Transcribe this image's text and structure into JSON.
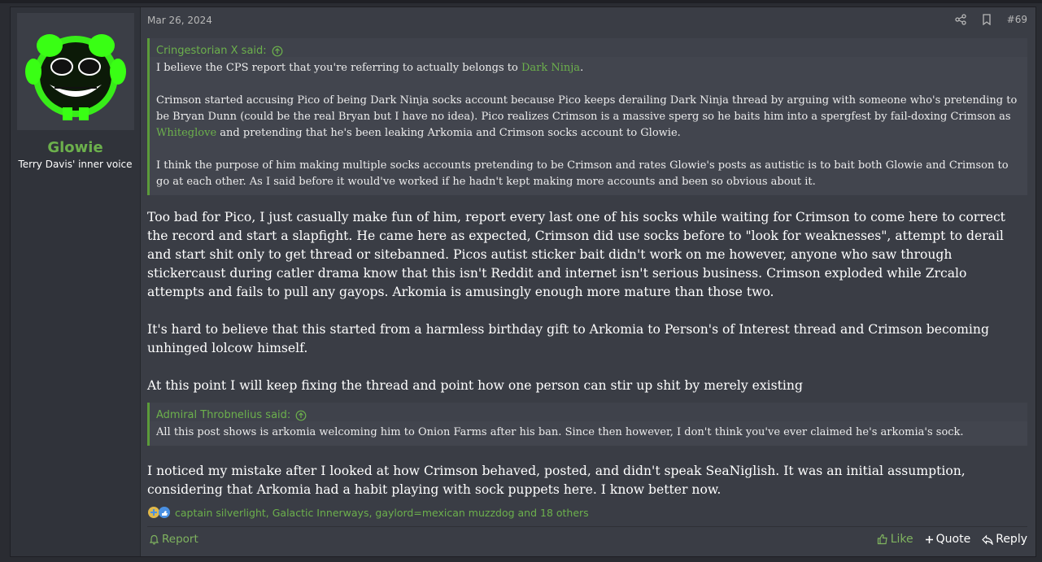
{
  "user": {
    "name": "Glowie",
    "title": "Terry Davis' inner voice"
  },
  "post": {
    "date": "Mar 26, 2024",
    "number": "#69",
    "quote1": {
      "author": "Cringestorian X said:",
      "p1_pre": "I believe the CPS report that you're referring to actually belongs to ",
      "p1_link": "Dark Ninja",
      "p1_post": ".",
      "p2_a": "Crimson started accusing Pico of being Dark Ninja socks account because Pico keeps derailing Dark Ninja thread by arguing with someone who's pretending to be Bryan Dunn (could be the real Bryan but I have no idea). Pico realizes Crimson is a massive sperg so he baits him into a spergfest by fail-doxing Crimson as ",
      "p2_link": "Whiteglove",
      "p2_b": " and pretending that he's been leaking Arkomia and Crimson socks account to Glowie.",
      "p3": "I think the purpose of him making multiple socks accounts pretending to be Crimson and rates Glowie's posts as autistic is to bait both Glowie and Crimson to go at each other. As I said before it would've worked if he hadn't kept making more accounts and been so obvious about it."
    },
    "body1": {
      "p1": "Too bad for Pico, I just casually make fun of him, report every last one of his socks while waiting for Crimson to come here to correct the record and start a slapfight. He came here as expected, Crimson did use socks before to \"look for weaknesses\", attempt to derail and start shit only to get thread or sitebanned. Picos autist sticker bait didn't work on me however, anyone who saw through stickercaust during catler drama know that this isn't Reddit and internet isn't serious business. Crimson exploded while Zrcalo attempts and fails to pull any gayops. Arkomia is amusingly enough more mature than those two.",
      "p2": "It's hard to believe that this started from a harmless birthday gift to Arkomia to Person's of Interest thread and Crimson becoming unhinged lolcow himself.",
      "p3": "At this point I will keep fixing the thread and point how one person can stir up shit by merely existing"
    },
    "quote2": {
      "author": "Admiral Throbnelius said:",
      "text": "All this post shows is arkomia welcoming him to Onion Farms after his ban. Since then however, I don't think you've ever claimed he's arkomia's sock."
    },
    "body2": "I noticed my mistake after I looked at how Crimson behaved, posted, and didn't speak SeaNiglish. It was an initial assumption, considering that Arkomia had a habit playing with sock puppets here. I know better now.",
    "reactions": "captain silverlight, Galactic Innerways, gaylord=mexican muzzdog and 18 others"
  },
  "footer": {
    "report": "Report",
    "like": "Like",
    "quote": "Quote",
    "reply": "Reply"
  },
  "colors": {
    "accent": "#6cb04c",
    "background": "#3a3d45",
    "quote_bg": "#42454e"
  }
}
